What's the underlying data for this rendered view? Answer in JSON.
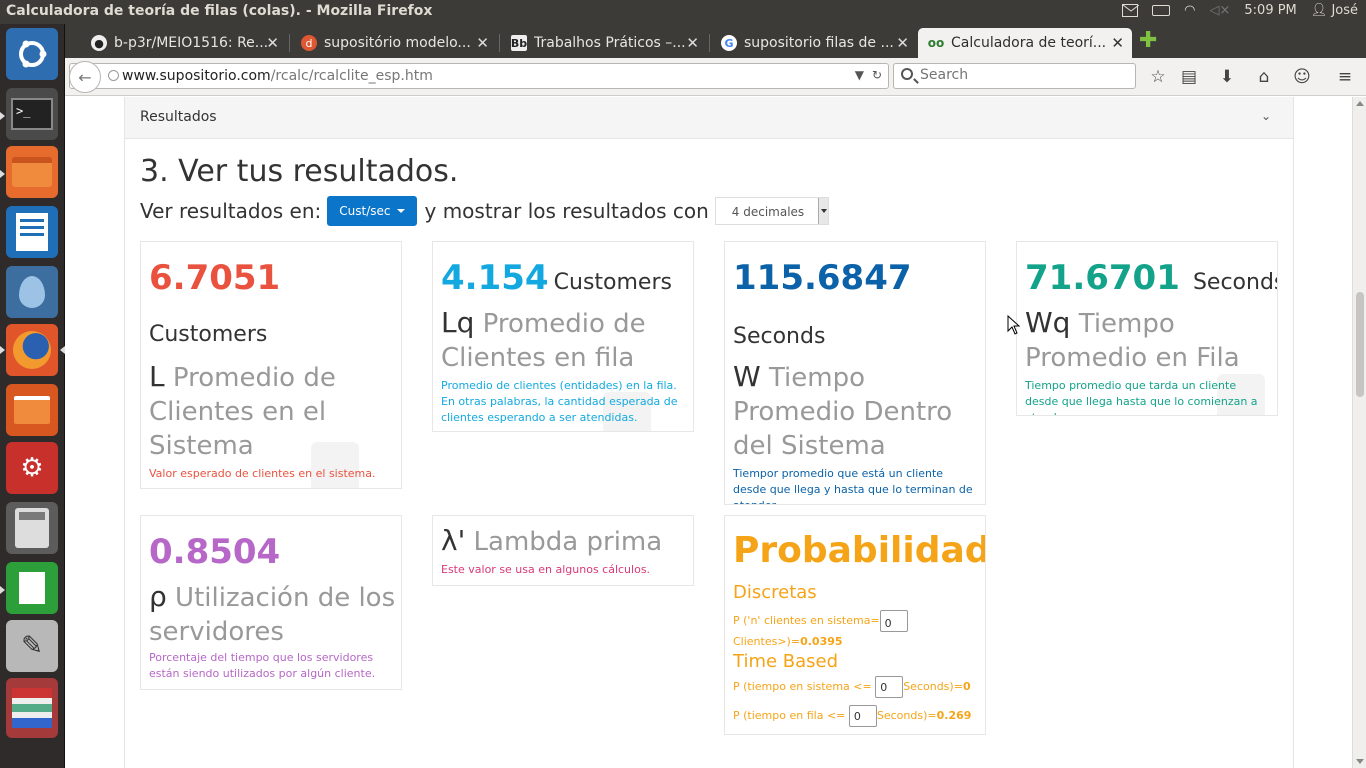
{
  "window": {
    "title": "Calculadora de teoría de filas (colas). - Mozilla Firefox",
    "clock": "5:09 PM",
    "user": "José"
  },
  "launcher": {
    "items": [
      "ubuntu-dash",
      "terminal",
      "files",
      "libreoffice-writer",
      "drop",
      "firefox",
      "software-center",
      "system-settings",
      "calculator",
      "libreoffice-calc",
      "text-editor",
      "stack"
    ]
  },
  "tabs": [
    {
      "label": "b-p3r/MEIO1516: Re...",
      "favicon": "github"
    },
    {
      "label": "supositório modelo...",
      "favicon": "duckduckgo"
    },
    {
      "label": "Trabalhos Práticos –...",
      "favicon": "blackboard"
    },
    {
      "label": "supositorio filas de ...",
      "favicon": "google"
    },
    {
      "label": "Calculadora de teorí...",
      "favicon": "suposition",
      "active": true
    }
  ],
  "nav": {
    "url_host": "www.supositorio.com",
    "url_path": "/rcalc/rcalclite_esp.htm",
    "search_placeholder": "Search"
  },
  "page": {
    "panel_title": "Resultados",
    "step_title": "3. Ver tus resultados.",
    "show_prefix": "Ver resultados en:",
    "units_button": "Cust/sec",
    "show_middle": "y mostrar los resultados con",
    "decimals_value": "4 decimales"
  },
  "cards": {
    "L": {
      "value": "6.7051",
      "unit": "Customers",
      "symbol": "L",
      "label": "Promedio de Clientes en el Sistema",
      "desc": "Valor esperado de clientes en el sistema.",
      "color": "#e8523f"
    },
    "Lq": {
      "value": "4.154",
      "unit": "Customers",
      "symbol": "Lq",
      "label": "Promedio de Clientes en fila",
      "desc": "Promedio de clientes (entidades) en la fila. En otras palabras, la cantidad esperada de clientes esperando a ser atendidas.",
      "color": "#13a9e0"
    },
    "W": {
      "value": "115.6847",
      "unit": "Seconds",
      "symbol": "W",
      "label": "Tiempo Promedio Dentro del Sistema",
      "desc": "Tiempor promedio que está un cliente desde que llega y hasta que lo terminan de atender.",
      "color": "#0b62a8"
    },
    "Wq": {
      "value": "71.6701",
      "unit": "Seconds",
      "symbol": "Wq",
      "label": "Tiempo Promedio en Fila",
      "desc": "Tiempo promedio que tarda un cliente desde que llega hasta que lo comienzan a atender.",
      "color": "#13a38a"
    },
    "rho": {
      "value": "0.8504",
      "symbol": "ρ",
      "label": "Utilización de los servidores",
      "desc": "Porcentaje del tiempo que los servidores están siendo utilizados por algún cliente.",
      "color": "#b667c7"
    },
    "lambda": {
      "symbol": "λ'",
      "label": "Lambda prima",
      "desc": "Este valor se usa en algunos cálculos.",
      "color": "#d93a78"
    },
    "prob": {
      "title": "Probabilidades",
      "discrete_title": "Discretas",
      "discrete_prefix": "P ('n' clientes en sistema=",
      "discrete_input": "0",
      "discrete_suffix": "Clientes>)=",
      "discrete_value": "0.0395",
      "time_title": "Time Based",
      "ts_prefix": "P (tiempo en sistema <=",
      "ts_input": "0",
      "ts_suffix": "Seconds)=",
      "ts_value": "0",
      "tq_prefix": "P (tiempo en fila <=",
      "tq_input": "0",
      "tq_suffix": "Seconds)=",
      "tq_value": "0.269",
      "color": "#f5a417"
    }
  },
  "colors": {
    "panel_bg": "#3c3b37",
    "accent_button": "#0b76c9"
  }
}
